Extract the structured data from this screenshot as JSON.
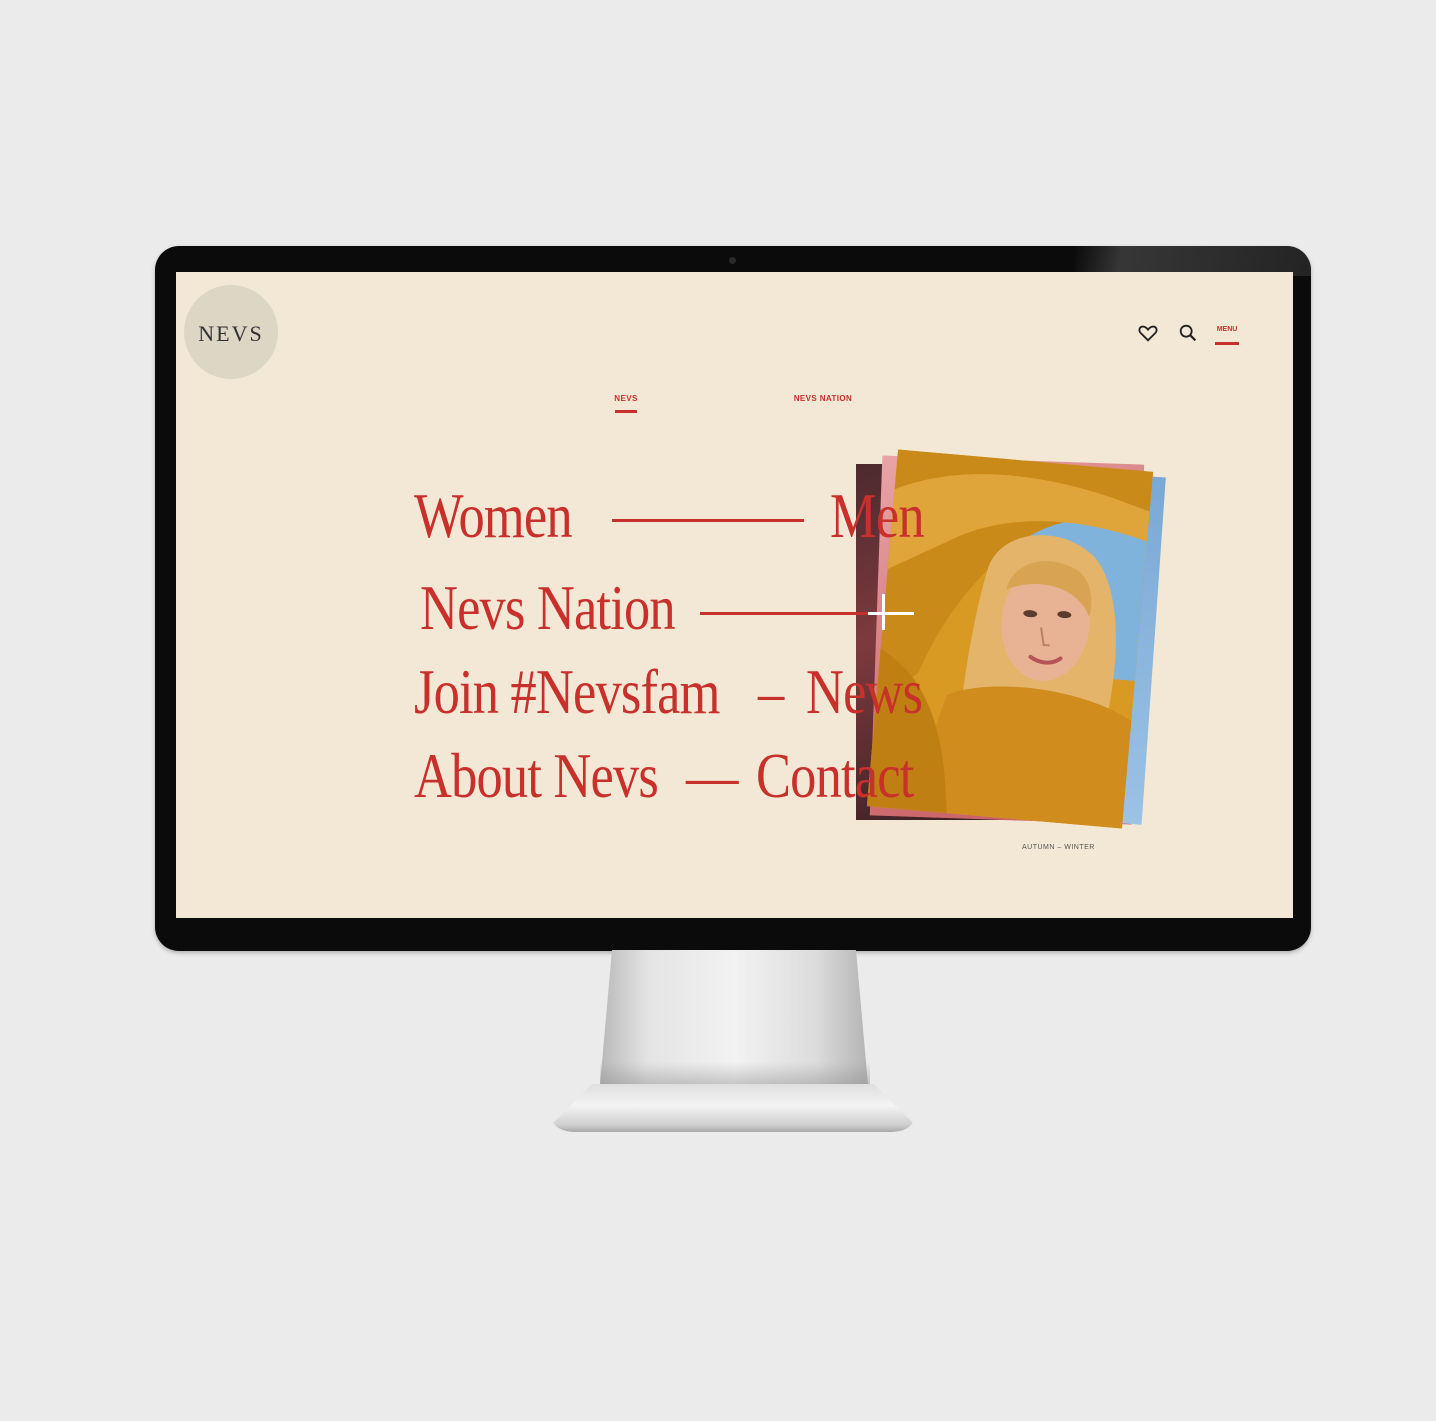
{
  "brand": {
    "logo_text": "NEVS"
  },
  "header": {
    "menu_label": "MENU",
    "icons": [
      "heart-icon",
      "search-icon"
    ]
  },
  "tabs": [
    {
      "label": "NEVS",
      "active": true
    },
    {
      "label": "NEVS NATION",
      "active": false
    }
  ],
  "main_menu": {
    "line1_left": "Women",
    "line1_right": "Men",
    "line2_left": "Nevs Nation",
    "line3_left": "Join #Nevsfam",
    "line3_sep": "–",
    "line3_right": "News",
    "line4_left": "About Nevs",
    "line4_sep": "—",
    "line4_right": "Contact"
  },
  "photo": {
    "caption": "AUTUMN – WINTER"
  },
  "colors": {
    "accent": "#c7302b",
    "screen_bg": "#f3e8d6",
    "page_bg": "#ebebeb"
  }
}
